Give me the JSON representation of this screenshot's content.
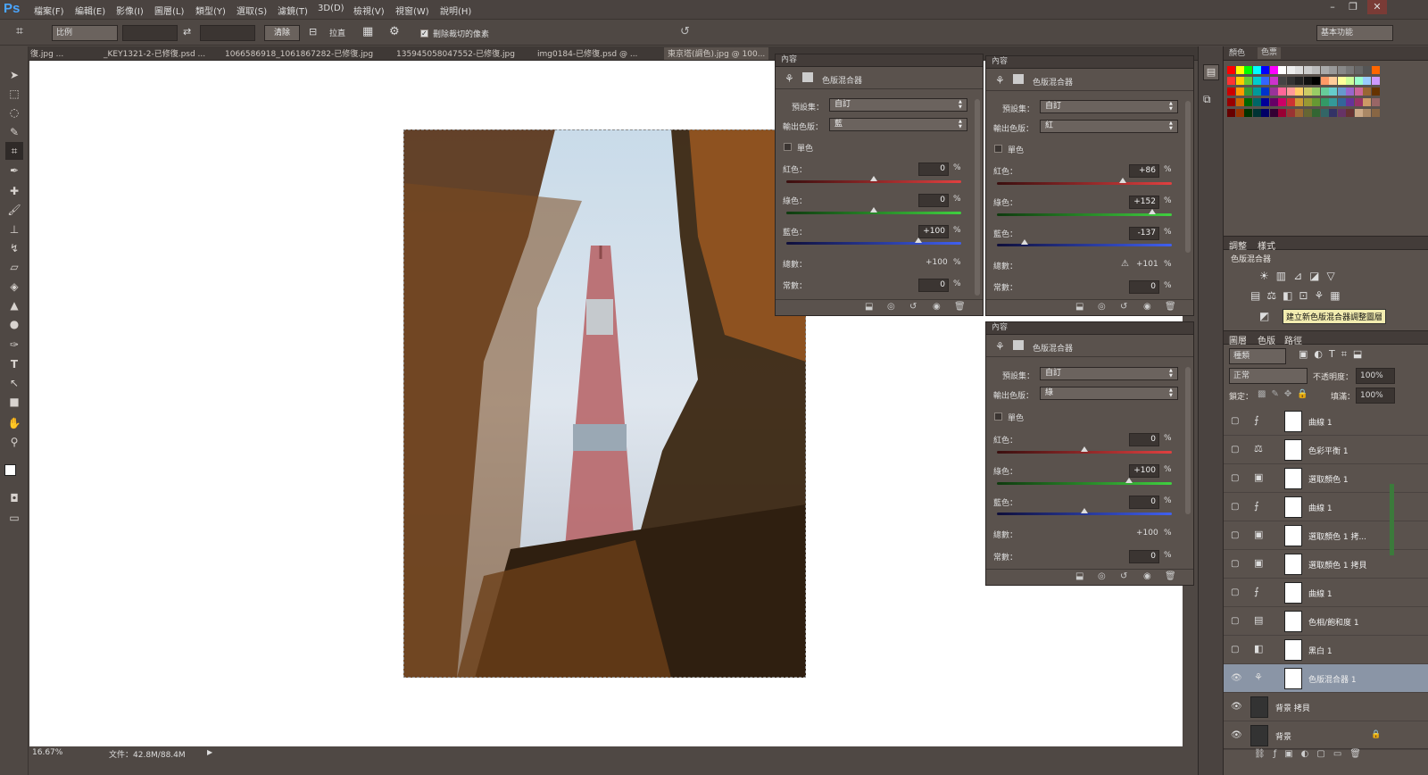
{
  "menubar": {
    "logo": "Ps",
    "items": [
      "檔案(F)",
      "編輯(E)",
      "影像(I)",
      "圖層(L)",
      "類型(Y)",
      "選取(S)",
      "濾鏡(T)",
      "3D(D)",
      "檢視(V)",
      "視窗(W)",
      "說明(H)"
    ],
    "window_controls": [
      "–",
      "❐",
      "✕"
    ]
  },
  "options": {
    "ratio_label": "比例",
    "clear_label": "清除",
    "straighten_label": "拉直",
    "delete_cropped_label": "刪除裁切的像素",
    "workspace_label": "基本功能"
  },
  "tabs": [
    "復.jpg ...",
    "_KEY1321-2-已修復.psd ...",
    "1066586918_1061867282-已修復.jpg",
    "135945058047552-已修復.jpg",
    "img0184-已修復.psd @ ...",
    "東京塔(調色).jpg @ 100..."
  ],
  "status": {
    "zoom": "16.67%",
    "doc": "文件：42.8M/88.4M"
  },
  "panels": [
    {
      "tab": "內容",
      "title": "色版混合器",
      "preset_label": "預設集：",
      "preset_value": "自訂",
      "output_label": "輸出色版：",
      "output_value": "藍",
      "mono_label": "單色",
      "red_label": "紅色：",
      "red_value": "0",
      "green_label": "綠色：",
      "green_value": "0",
      "blue_label": "藍色：",
      "blue_value": "+100",
      "total_label": "總數：",
      "total_value": "+100",
      "const_label": "常數：",
      "const_value": "0",
      "pct": "%",
      "warn": ""
    },
    {
      "tab": "內容",
      "title": "色版混合器",
      "preset_label": "預設集：",
      "preset_value": "自訂",
      "output_label": "輸出色版：",
      "output_value": "紅",
      "mono_label": "單色",
      "red_label": "紅色：",
      "red_value": "+86",
      "green_label": "綠色：",
      "green_value": "+152",
      "blue_label": "藍色：",
      "blue_value": "-137",
      "total_label": "總數：",
      "total_value": "+101",
      "const_label": "常數：",
      "const_value": "0",
      "pct": "%",
      "warn": "⚠"
    },
    {
      "tab": "內容",
      "title": "色版混合器",
      "preset_label": "預設集：",
      "preset_value": "自訂",
      "output_label": "輸出色版：",
      "output_value": "綠",
      "mono_label": "單色",
      "red_label": "紅色：",
      "red_value": "0",
      "green_label": "綠色：",
      "green_value": "+100",
      "blue_label": "藍色：",
      "blue_value": "0",
      "total_label": "總數：",
      "total_value": "+100",
      "const_label": "常數：",
      "const_value": "0",
      "pct": "%",
      "warn": ""
    }
  ],
  "right": {
    "color_tabs": [
      "顏色",
      "色票"
    ],
    "adj_tabs": [
      "調整",
      "樣式"
    ],
    "adj_title": "色版混合器",
    "tooltip": "建立新色版混合器調整圖層",
    "layer_tabs": [
      "圖層",
      "色版",
      "路徑"
    ],
    "kind_label": "種類",
    "blend_mode": "正常",
    "opacity_label": "不透明度：",
    "opacity_value": "100%",
    "lock_label": "鎖定：",
    "fill_label": "填滿：",
    "fill_value": "100%"
  },
  "layers": [
    {
      "name": "曲線 1",
      "icon": "⨍"
    },
    {
      "name": "色彩平衡 1",
      "icon": "⚖"
    },
    {
      "name": "選取顏色 1",
      "icon": "▣"
    },
    {
      "name": "曲線 1",
      "icon": "⨍"
    },
    {
      "name": "選取顏色 1 拷...",
      "icon": "▣"
    },
    {
      "name": "選取顏色 1 拷貝",
      "icon": "▣"
    },
    {
      "name": "曲線 1",
      "icon": "⨍"
    },
    {
      "name": "色相/飽和度 1",
      "icon": "▤"
    },
    {
      "name": "黑白 1",
      "icon": "◧"
    },
    {
      "name": "色版混合器 1",
      "icon": "⚘"
    },
    {
      "name": "背景 拷貝",
      "icon": ""
    },
    {
      "name": "背景",
      "icon": ""
    }
  ]
}
